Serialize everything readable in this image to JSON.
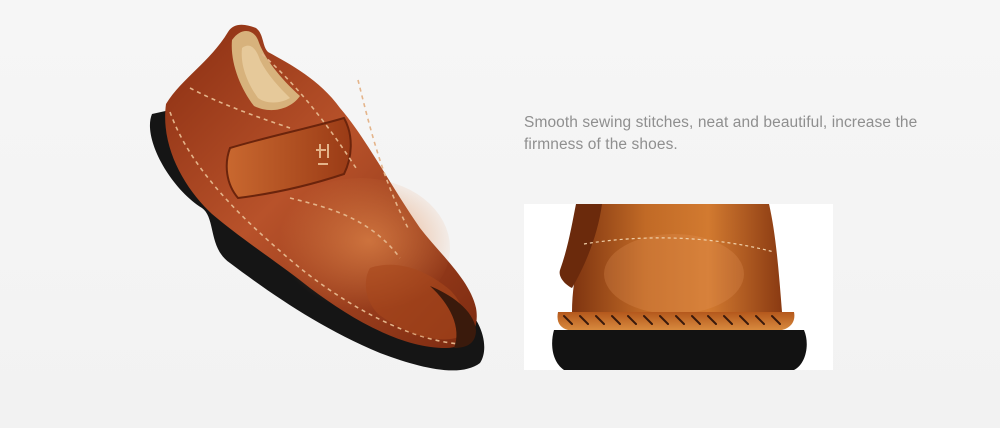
{
  "caption": {
    "text": "Smooth sewing stitches, neat and beautiful, increase the firmness of the shoes."
  },
  "colors": {
    "background": "#f4f4f4",
    "leather": "#a9471c",
    "leather_light": "#c8692e",
    "sole": "#161616",
    "stitch": "#e4b48a",
    "caption_text": "#8f8f8f"
  },
  "images": {
    "main": "brown-leather-loafer-side-view",
    "detail": "toe-stitching-closeup"
  }
}
